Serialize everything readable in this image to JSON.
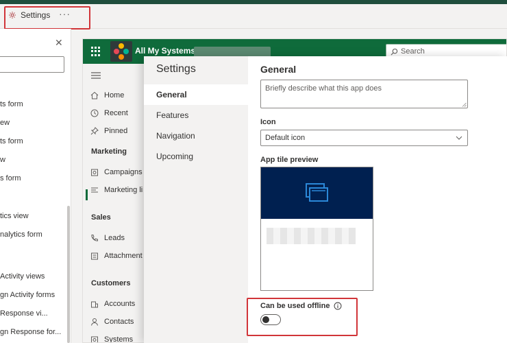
{
  "command_bar": {
    "settings_label": "Settings",
    "more_label": "···"
  },
  "left_pane": {
    "items": [
      "ts form",
      "ew",
      "ts form",
      "w",
      "s form",
      "tics view",
      "nalytics form",
      "Activity views",
      "gn Activity forms",
      "Response vi...",
      "gn Response for..."
    ]
  },
  "app": {
    "title": "All My Systems",
    "search_placeholder": "Search",
    "nav": {
      "home": "Home",
      "recent": "Recent",
      "pinned": "Pinned",
      "section_marketing": "Marketing",
      "campaigns": "Campaigns",
      "marketing_lists": "Marketing li",
      "section_sales": "Sales",
      "leads": "Leads",
      "attachments": "Attachment",
      "section_customers": "Customers",
      "accounts": "Accounts",
      "contacts": "Contacts",
      "systems": "Systems"
    }
  },
  "dialog": {
    "title": "Settings",
    "nav": [
      "General",
      "Features",
      "Navigation",
      "Upcoming"
    ],
    "active_nav": "General",
    "general": {
      "heading": "General",
      "description_placeholder": "Briefly describe what this app does",
      "icon_label": "Icon",
      "icon_value": "Default icon",
      "tile_preview_label": "App tile preview",
      "offline_label": "Can be used offline",
      "offline_enabled": false
    }
  },
  "colors": {
    "app_header": "#0f6b3b",
    "tile_background": "#002050",
    "tile_icon": "#2b88d8",
    "highlight": "#d13438"
  }
}
